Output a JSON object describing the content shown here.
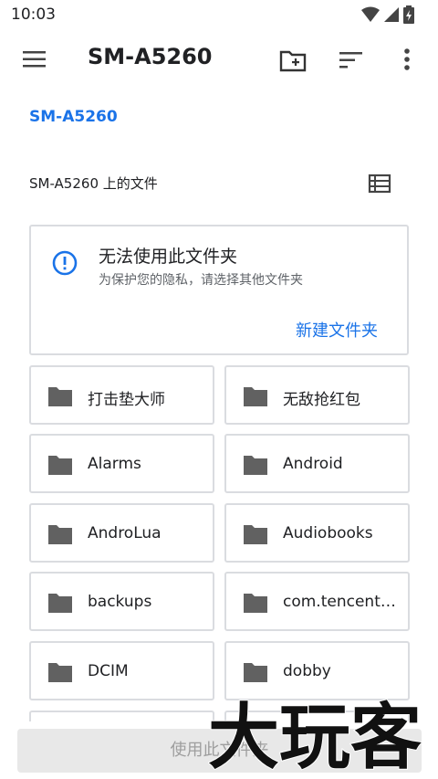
{
  "status_bar": {
    "time": "10:03",
    "icons": [
      "wifi-icon",
      "signal-icon",
      "battery-icon"
    ]
  },
  "app_bar": {
    "title": "SM-A5260",
    "icons": [
      "menu-icon",
      "new-folder-icon",
      "sort-icon",
      "more-vert-icon"
    ]
  },
  "breadcrumb": {
    "root": "SM-A5260"
  },
  "section": {
    "title": "SM-A5260 上的文件",
    "view_icon": "list-view-icon"
  },
  "info_card": {
    "title": "无法使用此文件夹",
    "subtitle": "为保护您的隐私，请选择其他文件夹",
    "action": "新建文件夹",
    "icon": "info-icon"
  },
  "folders": [
    {
      "name": "打击垫大师"
    },
    {
      "name": "无敌抢红包"
    },
    {
      "name": "Alarms"
    },
    {
      "name": "Android"
    },
    {
      "name": "AndroLua"
    },
    {
      "name": "Audiobooks"
    },
    {
      "name": "backups"
    },
    {
      "name": "com.tencent...."
    },
    {
      "name": "DCIM"
    },
    {
      "name": "dobby"
    }
  ],
  "footer": {
    "button_label": "使用此文件夹"
  },
  "watermark": {
    "text": "大玩客"
  },
  "colors": {
    "accent": "#1a73e8",
    "folder_icon": "#616161",
    "card_border": "#dadce0"
  }
}
